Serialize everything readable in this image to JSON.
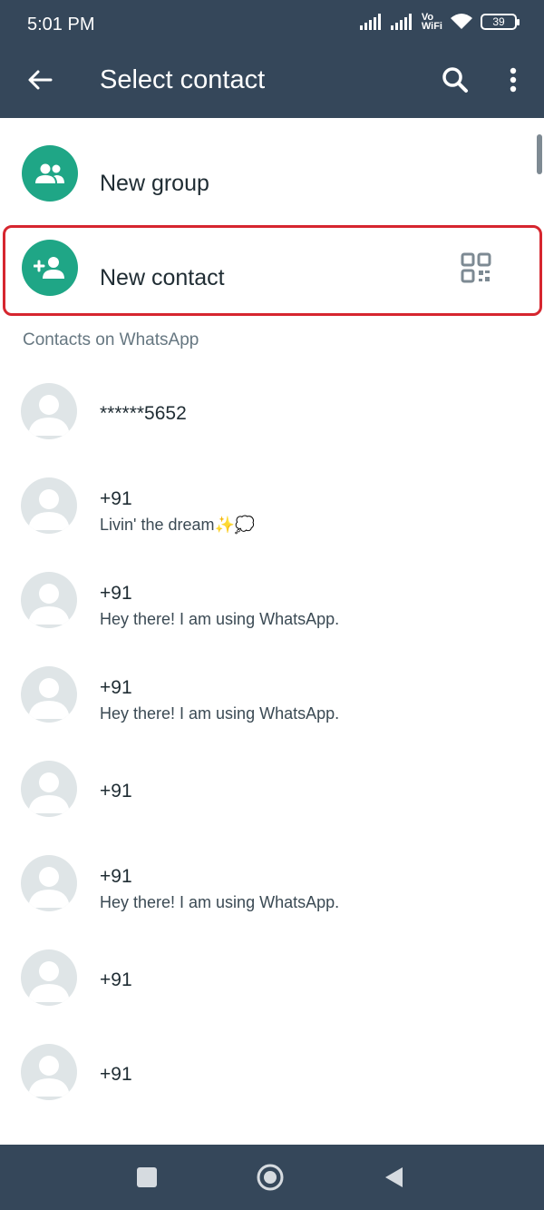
{
  "status_bar": {
    "time": "5:01 PM",
    "network_label_top": "Vo",
    "network_label_bottom": "WiFi",
    "battery": "39"
  },
  "app_bar": {
    "title": "Select contact"
  },
  "actions": {
    "new_group": "New group",
    "new_contact": "New contact"
  },
  "section_header": "Contacts on WhatsApp",
  "contacts": [
    {
      "name": "******5652",
      "status": ""
    },
    {
      "name": "+91",
      "status": "Livin' the dream✨💭"
    },
    {
      "name": "+91",
      "status": "Hey there! I am using WhatsApp."
    },
    {
      "name": "+91",
      "status": "Hey there! I am using WhatsApp."
    },
    {
      "name": "+91",
      "status": ""
    },
    {
      "name": "+91",
      "status": "Hey there! I am using WhatsApp."
    },
    {
      "name": "+91",
      "status": ""
    },
    {
      "name": "+91",
      "status": ""
    }
  ],
  "colors": {
    "header": "#35475a",
    "accent": "#1fa686",
    "highlight_border": "#d6262f"
  }
}
